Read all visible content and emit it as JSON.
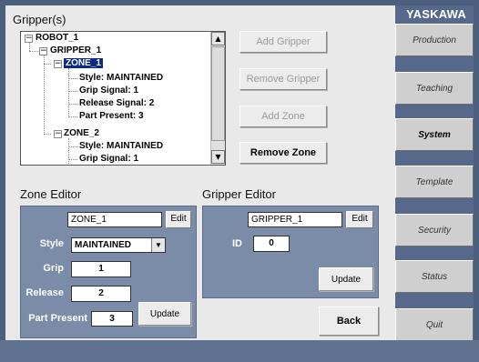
{
  "brand": "YASKAWA",
  "nav": [
    {
      "label": "Production"
    },
    {
      "label": "Teaching"
    },
    {
      "label": "System"
    },
    {
      "label": "Template"
    },
    {
      "label": "Security"
    },
    {
      "label": "Status"
    },
    {
      "label": "Quit"
    }
  ],
  "grippers_title": "Gripper(s)",
  "tree": {
    "robot": "ROBOT_1",
    "gripper": "GRIPPER_1",
    "zone1": {
      "name": "ZONE_1",
      "style": "Style: MAINTAINED",
      "grip": "Grip Signal: 1",
      "release": "Release Signal: 2",
      "part": "Part Present: 3"
    },
    "zone2": {
      "name": "ZONE_2",
      "style": "Style: MAINTAINED",
      "grip": "Grip Signal: 1"
    }
  },
  "actions": {
    "add_gripper": "Add Gripper",
    "remove_gripper": "Remove Gripper",
    "add_zone": "Add Zone",
    "remove_zone": "Remove Zone"
  },
  "zone_editor": {
    "title": "Zone Editor",
    "name_value": "ZONE_1",
    "edit": "Edit",
    "style_label": "Style",
    "style_value": "MAINTAINED",
    "grip_label": "Grip",
    "grip_value": "1",
    "release_label": "Release",
    "release_value": "2",
    "part_label": "Part Present",
    "part_value": "3",
    "update": "Update"
  },
  "gripper_editor": {
    "title": "Gripper Editor",
    "name_value": "GRIPPER_1",
    "edit": "Edit",
    "id_label": "ID",
    "id_value": "0",
    "update": "Update"
  },
  "back": "Back"
}
